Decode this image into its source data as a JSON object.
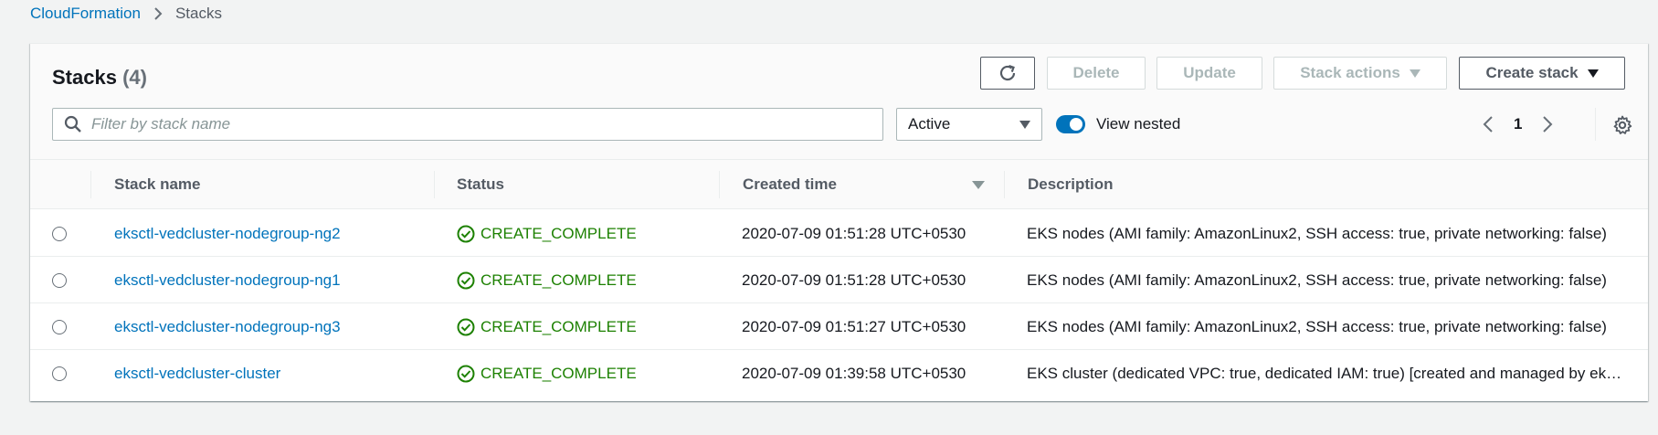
{
  "breadcrumb": {
    "parent": "CloudFormation",
    "current": "Stacks"
  },
  "header": {
    "title": "Stacks",
    "count": "(4)",
    "buttons": {
      "delete": "Delete",
      "update": "Update",
      "stack_actions": "Stack actions",
      "create_stack": "Create stack"
    }
  },
  "filter": {
    "placeholder": "Filter by stack name",
    "status_select": "Active",
    "view_nested_label": "View nested",
    "view_nested_on": true
  },
  "pagination": {
    "page": "1"
  },
  "table": {
    "columns": [
      "Stack name",
      "Status",
      "Created time",
      "Description"
    ],
    "rows": [
      {
        "name": "eksctl-vedcluster-nodegroup-ng2",
        "status": "CREATE_COMPLETE",
        "created": "2020-07-09 01:51:28 UTC+0530",
        "description": "EKS nodes (AMI family: AmazonLinux2, SSH access: true, private networking: false)"
      },
      {
        "name": "eksctl-vedcluster-nodegroup-ng1",
        "status": "CREATE_COMPLETE",
        "created": "2020-07-09 01:51:28 UTC+0530",
        "description": "EKS nodes (AMI family: AmazonLinux2, SSH access: true, private networking: false)"
      },
      {
        "name": "eksctl-vedcluster-nodegroup-ng3",
        "status": "CREATE_COMPLETE",
        "created": "2020-07-09 01:51:27 UTC+0530",
        "description": "EKS nodes (AMI family: AmazonLinux2, SSH access: true, private networking: false)"
      },
      {
        "name": "eksctl-vedcluster-cluster",
        "status": "CREATE_COMPLETE",
        "created": "2020-07-09 01:39:58 UTC+0530",
        "description": "EKS cluster (dedicated VPC: true, dedicated IAM: true) [created and managed by eksctl]"
      }
    ]
  },
  "colors": {
    "link": "#0073bb",
    "success": "#1d8102",
    "toggle": "#0073bb"
  },
  "icons": [
    "chevron-right-icon",
    "refresh-icon",
    "search-icon",
    "caret-down-icon",
    "chevron-left-icon",
    "gear-icon",
    "check-circle-icon"
  ]
}
